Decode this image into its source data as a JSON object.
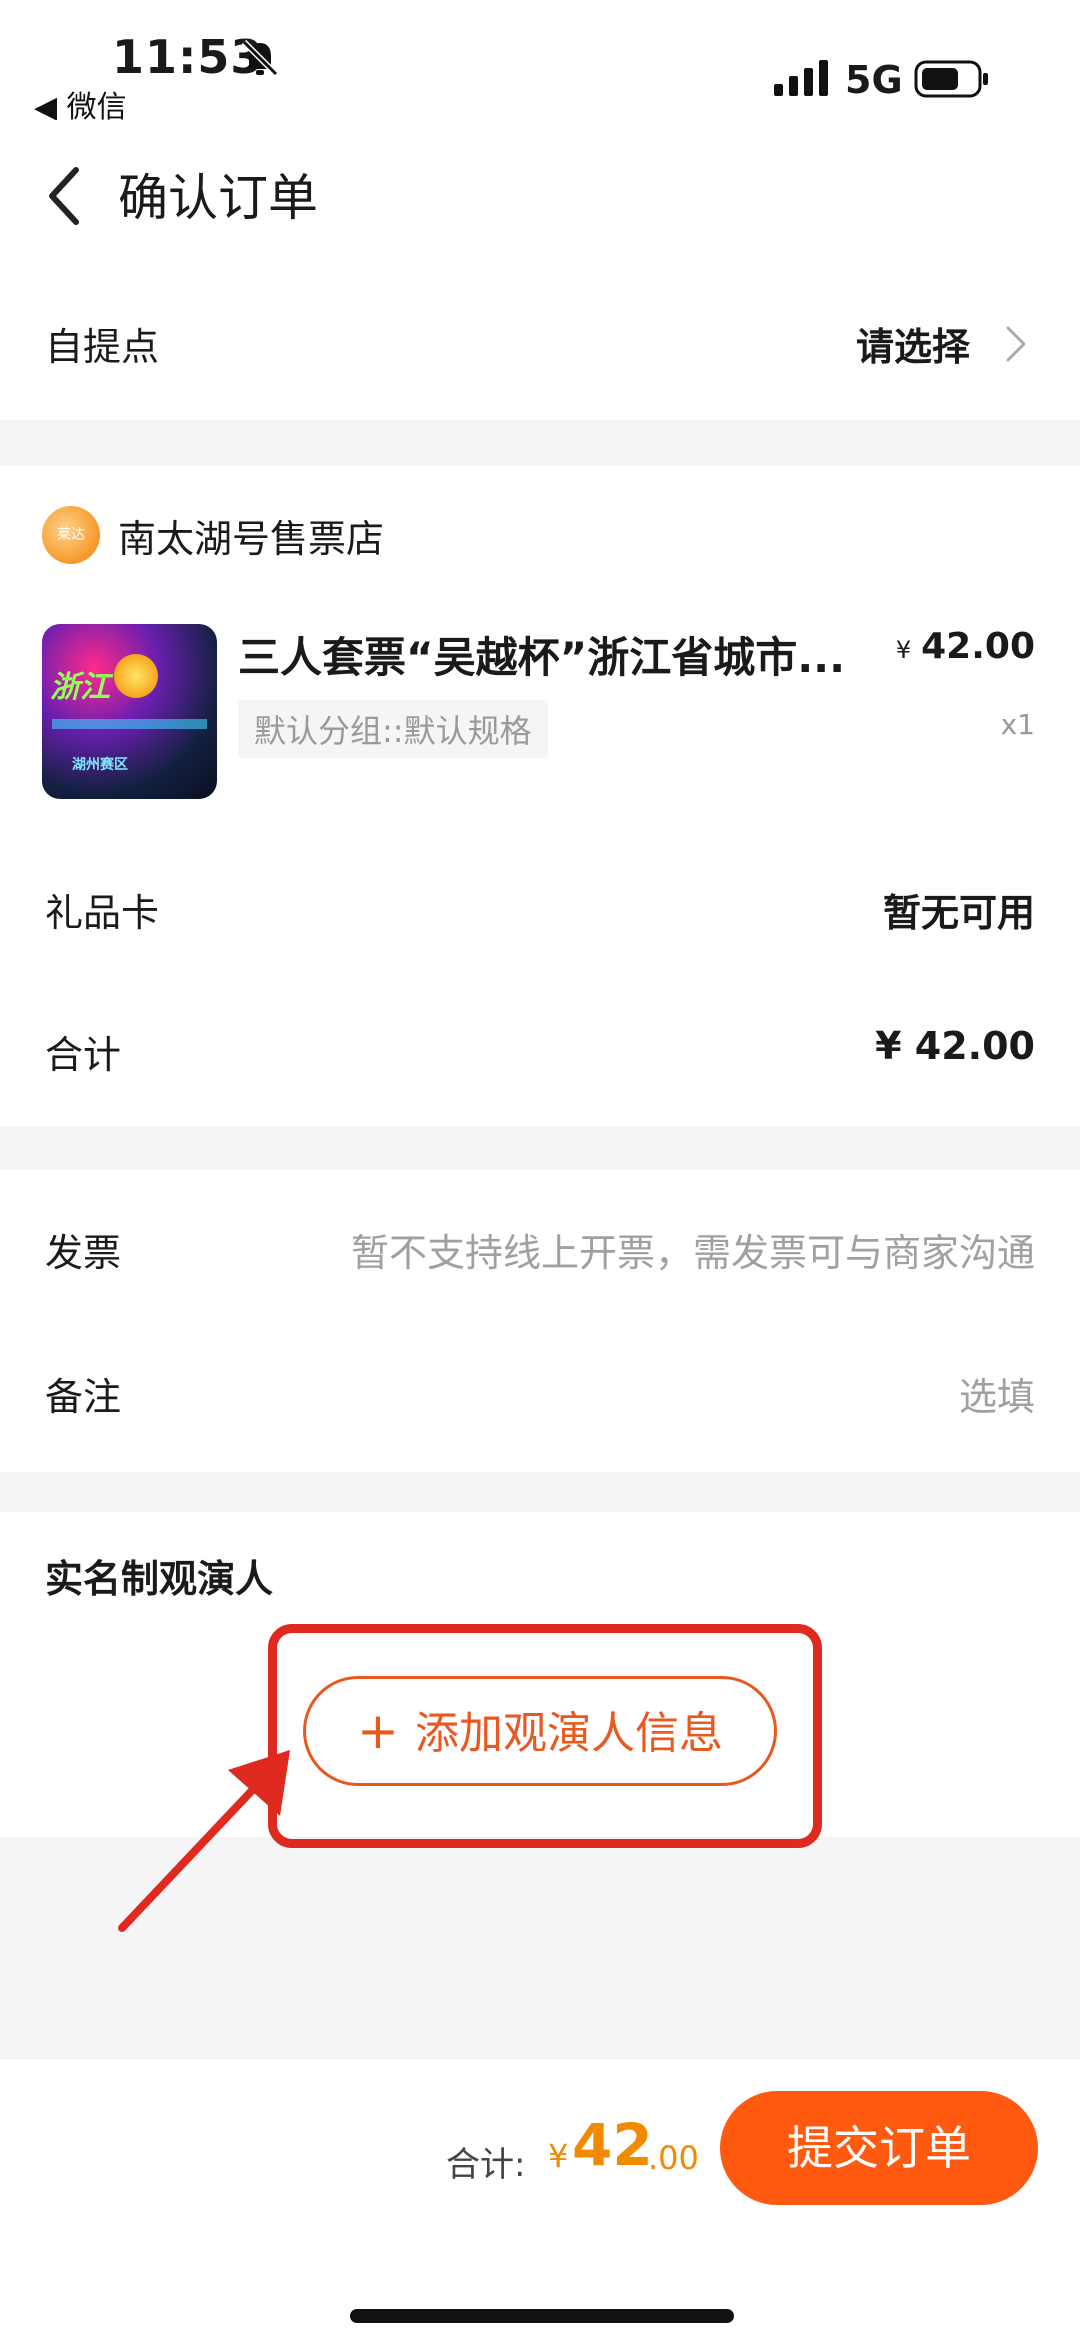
{
  "status_bar": {
    "time": "11:53",
    "back_app": "◀ 微信",
    "network": "5G"
  },
  "nav": {
    "title": "确认订单"
  },
  "pickup": {
    "label": "自提点",
    "value": "请选择"
  },
  "store": {
    "logo_text": "莱达",
    "name": "南太湖号售票店",
    "product": {
      "title": "三人套票“吴越杯”浙江省城市...",
      "currency": "¥",
      "price": "42.00",
      "spec": "默认分组::默认规格",
      "quantity": "x1",
      "thumb_text": "浙江",
      "thumb_sub": "湖州赛区"
    },
    "gift_card": {
      "label": "礼品卡",
      "value": "暂无可用"
    },
    "total": {
      "label": "合计",
      "value": "¥ 42.00"
    }
  },
  "invoice": {
    "label": "发票",
    "value": "暂不支持线上开票，需发票可与商家沟通"
  },
  "note": {
    "label": "备注",
    "placeholder": "选填"
  },
  "viewer": {
    "title": "实名制观演人",
    "add_button": "添加观演人信息",
    "plus": "+"
  },
  "bottom": {
    "total_label": "合计:",
    "currency": "¥",
    "total_int": "42",
    "total_dec": ".00",
    "submit": "提交订单"
  },
  "colors": {
    "accent": "#ff5a10",
    "price": "#f28a00",
    "annotation": "#e0291f"
  },
  "icons": [
    "bell-slash-icon",
    "signal-icon",
    "battery-icon",
    "back-arrow-icon",
    "chevron-right-icon",
    "plus-icon"
  ]
}
